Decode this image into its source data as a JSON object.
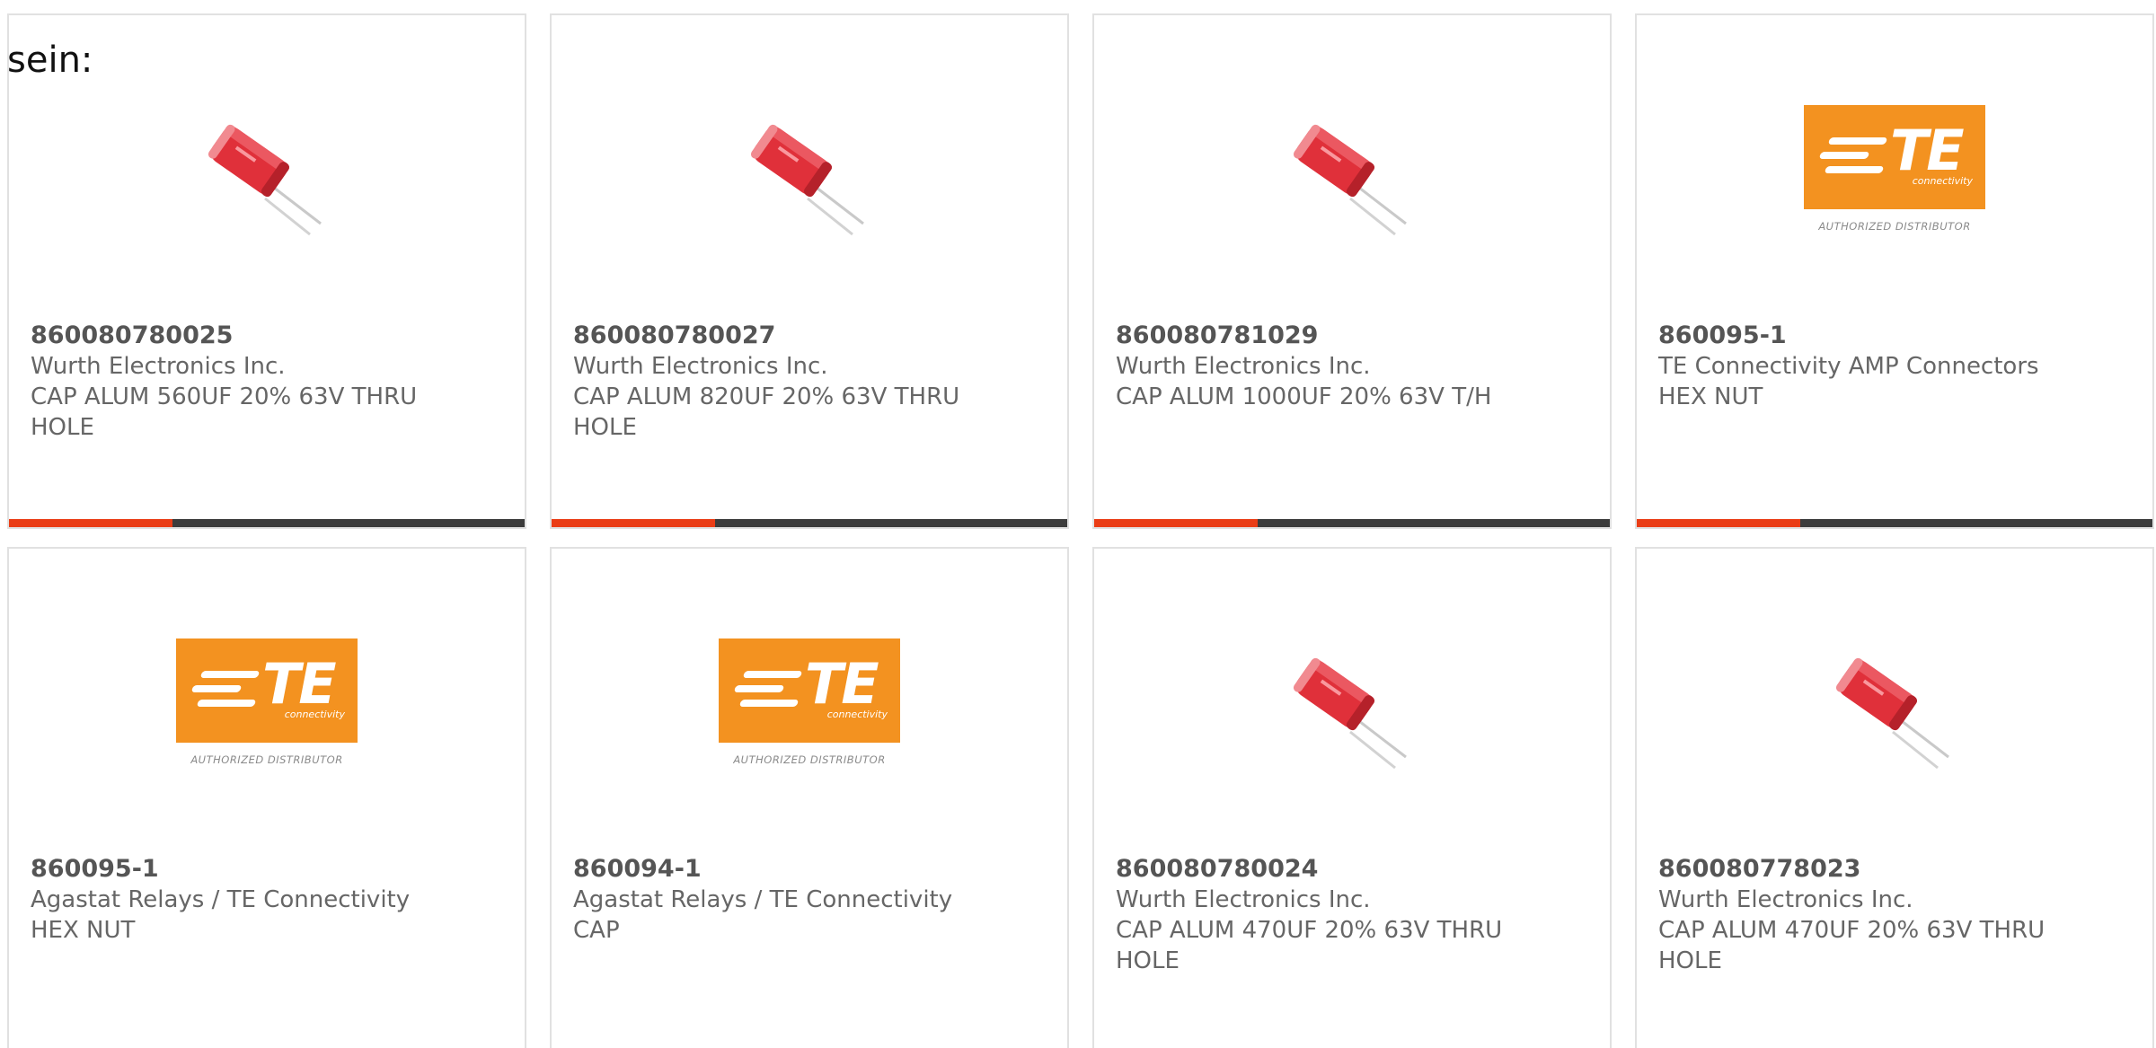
{
  "intro_text": "sein:",
  "colors": {
    "accent": "#ea3d16",
    "bar": "#3c3c3c",
    "te_orange": "#f39220",
    "capacitor_red": "#e0303a"
  },
  "te_logo": {
    "letters": "TE",
    "sub": "connectivity",
    "authorized": "AUTHORIZED DISTRIBUTOR"
  },
  "products": [
    {
      "part_number": "860080780025",
      "manufacturer": "Wurth Electronics Inc.",
      "description": "CAP ALUM 560UF 20% 63V THRU HOLE",
      "image": "capacitor-image",
      "accent_bar": true
    },
    {
      "part_number": "860080780027",
      "manufacturer": "Wurth Electronics Inc.",
      "description": "CAP ALUM 820UF 20% 63V THRU HOLE",
      "image": "capacitor-image",
      "accent_bar": true
    },
    {
      "part_number": "860080781029",
      "manufacturer": "Wurth Electronics Inc.",
      "description": "CAP ALUM 1000UF 20% 63V T/H",
      "image": "capacitor-image",
      "accent_bar": true
    },
    {
      "part_number": "860095-1",
      "manufacturer": "TE Connectivity AMP Connectors",
      "description": "HEX NUT",
      "image": "te-logo",
      "accent_bar": true
    },
    {
      "part_number": "860095-1",
      "manufacturer": "Agastat Relays / TE Connectivity",
      "description": "HEX NUT",
      "image": "te-logo",
      "accent_bar": false
    },
    {
      "part_number": "860094-1",
      "manufacturer": "Agastat Relays / TE Connectivity",
      "description": "CAP",
      "image": "te-logo",
      "accent_bar": false
    },
    {
      "part_number": "860080780024",
      "manufacturer": "Wurth Electronics Inc.",
      "description": "CAP ALUM 470UF 20% 63V THRU HOLE",
      "image": "capacitor-image",
      "accent_bar": false
    },
    {
      "part_number": "860080778023",
      "manufacturer": "Wurth Electronics Inc.",
      "description": "CAP ALUM 470UF 20% 63V THRU HOLE",
      "image": "capacitor-image",
      "accent_bar": false
    }
  ]
}
